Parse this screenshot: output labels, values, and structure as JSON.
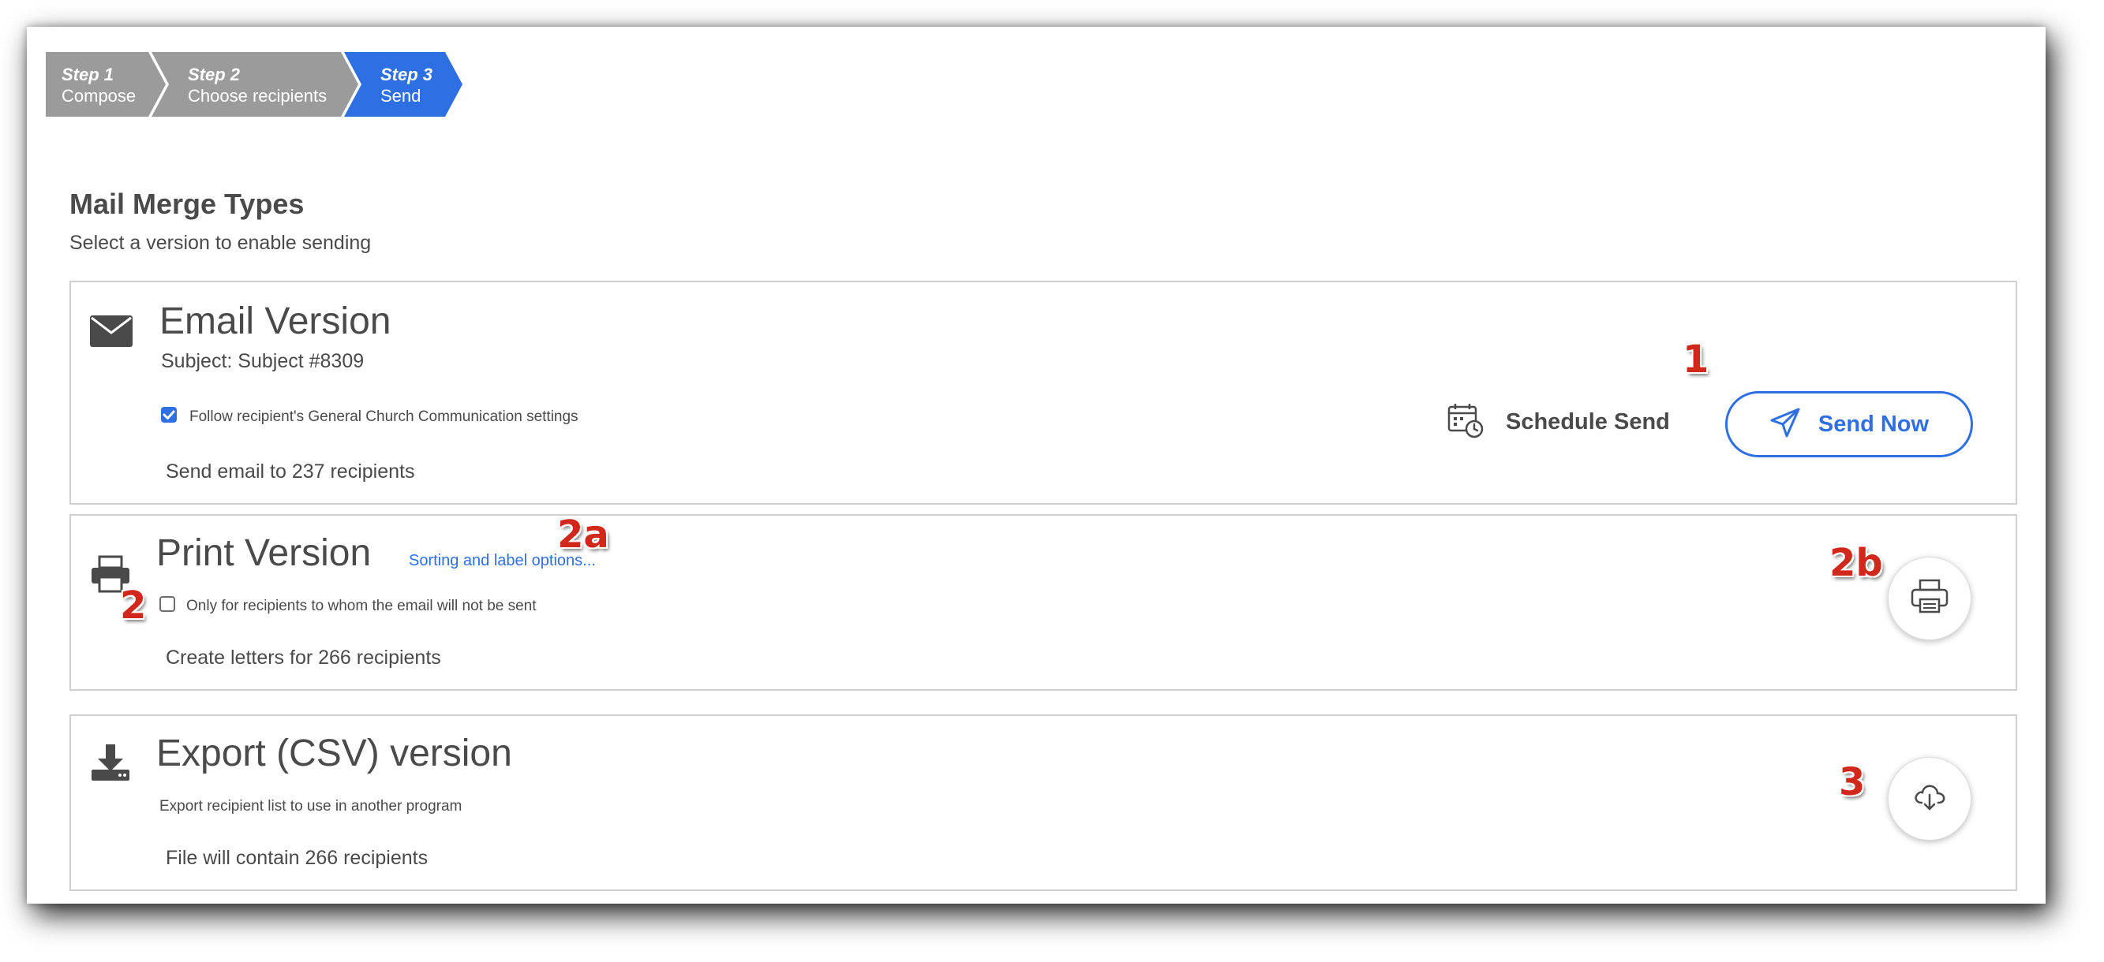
{
  "stepper": {
    "steps": [
      {
        "num": "Step 1",
        "label": "Compose"
      },
      {
        "num": "Step 2",
        "label": "Choose recipients"
      },
      {
        "num": "Step 3",
        "label": "Send"
      }
    ],
    "active_step": 3
  },
  "section": {
    "title": "Mail Merge Types",
    "subtitle": "Select a version to enable sending"
  },
  "email": {
    "heading": "Email Version",
    "subject": "Subject: Subject #8309",
    "follow_settings_label": "Follow recipient's General Church Communication settings",
    "follow_settings_checked": true,
    "recipients_text": "Send email to 237 recipients",
    "schedule_label": "Schedule Send",
    "send_now_label": "Send Now"
  },
  "print": {
    "heading": "Print Version",
    "options_link": "Sorting and label options...",
    "only_label": "Only for recipients to whom the email will not be sent",
    "only_checked": false,
    "recipients_text": "Create letters for 266 recipients"
  },
  "export": {
    "heading": "Export (CSV) version",
    "description": "Export recipient list to use in another program",
    "recipients_text": "File will contain 266 recipients"
  },
  "callouts": {
    "c1": "1",
    "c2": "2",
    "c2a": "2a",
    "c2b": "2b",
    "c3": "3"
  },
  "colors": {
    "accent": "#2f6fe4",
    "step_inactive": "#9b9b9b",
    "callout": "#d0281b",
    "text": "#4a4a4a"
  },
  "icons": {
    "email": "envelope-icon",
    "print": "printer-icon",
    "export": "download-icon",
    "schedule": "calendar-clock-icon",
    "send": "paper-plane-icon",
    "print_button": "printer-icon",
    "export_button": "cloud-download-icon"
  }
}
